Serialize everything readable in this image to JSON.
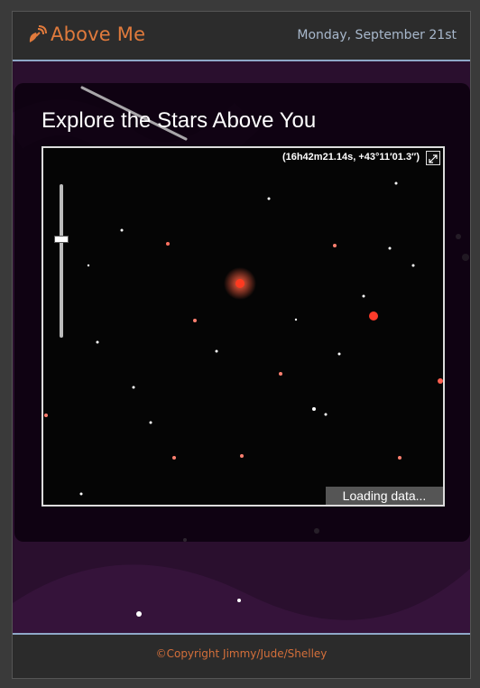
{
  "header": {
    "title": "Above Me",
    "date": "Monday, September 21st",
    "logo_icon": "satellite-dish-icon"
  },
  "main": {
    "heading": "Explore the Stars Above You",
    "viewer": {
      "coordinates": "(16h42m21.14s, +43°11′01.3″)",
      "loading_text": "Loading data...",
      "fullscreen_icon": "fullscreen-icon"
    }
  },
  "footer": {
    "copyright": "©Copyright Jimmy/Jude/Shelley"
  },
  "colors": {
    "accent": "#e07a3c",
    "space": "#2a0f2e",
    "divider": "#8fa8c8"
  }
}
